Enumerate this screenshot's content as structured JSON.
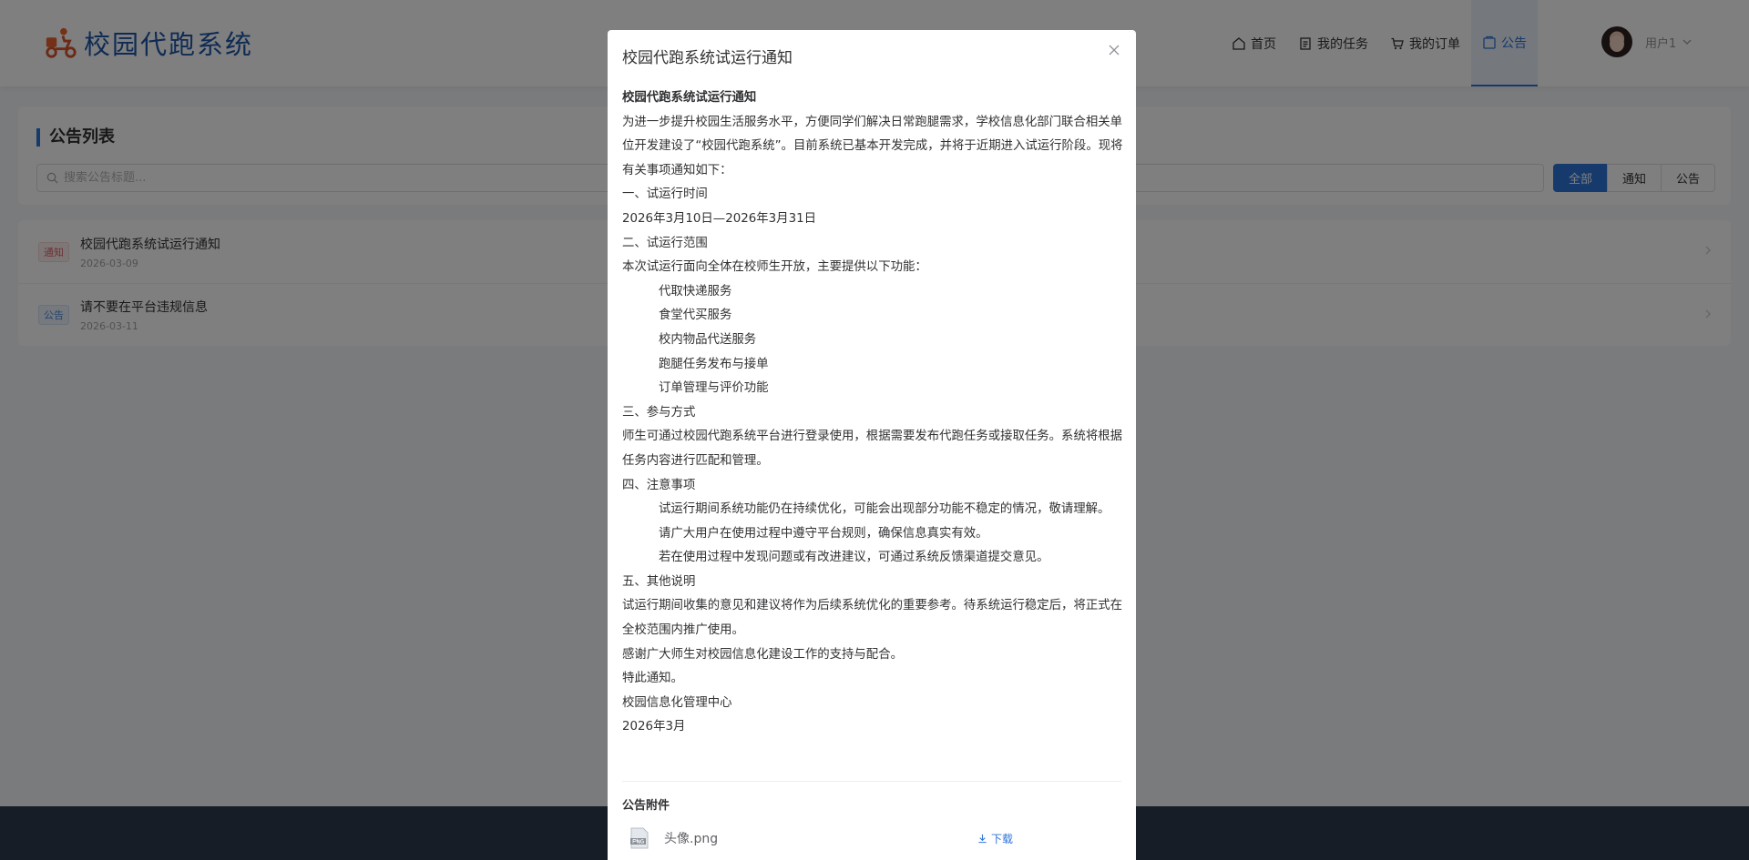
{
  "app": {
    "title": "校园代跑系统"
  },
  "nav": [
    {
      "label": "首页",
      "icon": "home-icon"
    },
    {
      "label": "我的任务",
      "icon": "document-icon"
    },
    {
      "label": "我的订单",
      "icon": "cart-icon"
    },
    {
      "label": "公告",
      "icon": "announcement-icon",
      "active": true
    }
  ],
  "user": {
    "name": "用户1"
  },
  "list": {
    "title": "公告列表",
    "search_placeholder": "搜索公告标题...",
    "filters": [
      "全部",
      "通知",
      "公告"
    ],
    "active_filter": "全部",
    "items": [
      {
        "tag": "通知",
        "title": "校园代跑系统试运行通知",
        "date": "2026-03-09"
      },
      {
        "tag": "公告",
        "title": "请不要在平台违规信息",
        "date": "2026-03-11"
      }
    ]
  },
  "dialog": {
    "title": "校园代跑系统试运行通知",
    "lines": [
      "校园代跑系统试运行通知",
      "为进一步提升校园生活服务水平，方便同学们解决日常跑腿需求，学校信息化部门联合相关单位开发建设了“校园代跑系统”。目前系统已基本开发完成，并将于近期进入试运行阶段。现将有关事项通知如下：",
      "一、试运行时间",
      "2026年3月10日—2026年3月31日",
      "二、试运行范围",
      "本次试运行面向全体在校师生开放，主要提供以下功能：",
      "代取快递服务",
      "食堂代买服务",
      "校内物品代送服务",
      "跑腿任务发布与接单",
      "订单管理与评价功能",
      "三、参与方式",
      "师生可通过校园代跑系统平台进行登录使用，根据需要发布代跑任务或接取任务。系统将根据任务内容进行匹配和管理。",
      "四、注意事项",
      "试运行期间系统功能仍在持续优化，可能会出现部分功能不稳定的情况，敬请理解。",
      "请广大用户在使用过程中遵守平台规则，确保信息真实有效。",
      "若在使用过程中发现问题或有改进建议，可通过系统反馈渠道提交意见。",
      "五、其他说明",
      "试运行期间收集的意见和建议将作为后续系统优化的重要参考。待系统运行稳定后，将正式在全校范围内推广使用。",
      "感谢广大师生对校园信息化建设工作的支持与配合。",
      "特此通知。",
      "校园信息化管理中心",
      "2026年3月"
    ],
    "attachments_title": "公告附件",
    "attachment": {
      "name": "头像.png",
      "download_label": "下载"
    }
  },
  "colors": {
    "accent": "#2f74d8",
    "brand": "#1f56a8",
    "footer": "#2f3b4c"
  }
}
